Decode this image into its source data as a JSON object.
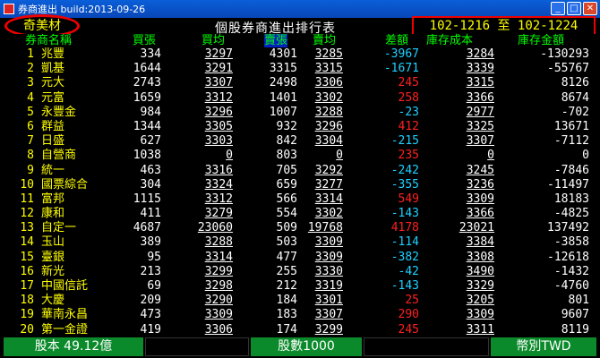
{
  "window": {
    "title": "券商進出 build:2013-09-26",
    "buttons": [
      "_",
      "□",
      "✕"
    ]
  },
  "header": {
    "broker": "奇美材",
    "table_title": "個股券商進出排行表",
    "date_range": "102-1216 至 102-1224"
  },
  "columns": {
    "rank_name": "券商名稱",
    "buy_lots": "買張",
    "buy_avg": "買均",
    "sell_lots": "賣張",
    "sell_avg": "賣均",
    "diff": "差額",
    "cost": "庫存成本",
    "amount": "庫存金額"
  },
  "rows": [
    {
      "no": "1",
      "name": "兆豐",
      "buy": "334",
      "bavg": "3297",
      "sell": "4301",
      "savg": "3285",
      "diff": "-3967",
      "cost": "3284",
      "amt": "-130293"
    },
    {
      "no": "2",
      "name": "凱基",
      "buy": "1644",
      "bavg": "3291",
      "sell": "3315",
      "savg": "3315",
      "diff": "-1671",
      "cost": "3339",
      "amt": "-55767"
    },
    {
      "no": "3",
      "name": "元大",
      "buy": "2743",
      "bavg": "3307",
      "sell": "2498",
      "savg": "3306",
      "diff": "245",
      "cost": "3315",
      "amt": "8126"
    },
    {
      "no": "4",
      "name": "元富",
      "buy": "1659",
      "bavg": "3312",
      "sell": "1401",
      "savg": "3302",
      "diff": "258",
      "cost": "3366",
      "amt": "8674"
    },
    {
      "no": "5",
      "name": "永豐金",
      "buy": "984",
      "bavg": "3296",
      "sell": "1007",
      "savg": "3288",
      "diff": "-23",
      "cost": "2977",
      "amt": "-702"
    },
    {
      "no": "6",
      "name": "群益",
      "buy": "1344",
      "bavg": "3305",
      "sell": "932",
      "savg": "3296",
      "diff": "412",
      "cost": "3325",
      "amt": "13671"
    },
    {
      "no": "7",
      "name": "日盛",
      "buy": "627",
      "bavg": "3303",
      "sell": "842",
      "savg": "3304",
      "diff": "-215",
      "cost": "3307",
      "amt": "-7112"
    },
    {
      "no": "8",
      "name": "自營商",
      "buy": "1038",
      "bavg": "0",
      "sell": "803",
      "savg": "0",
      "diff": "235",
      "cost": "0",
      "amt": "0"
    },
    {
      "no": "9",
      "name": "統一",
      "buy": "463",
      "bavg": "3316",
      "sell": "705",
      "savg": "3292",
      "diff": "-242",
      "cost": "3245",
      "amt": "-7846"
    },
    {
      "no": "10",
      "name": "國票綜合",
      "buy": "304",
      "bavg": "3324",
      "sell": "659",
      "savg": "3277",
      "diff": "-355",
      "cost": "3236",
      "amt": "-11497"
    },
    {
      "no": "11",
      "name": "富邦",
      "buy": "1115",
      "bavg": "3312",
      "sell": "566",
      "savg": "3314",
      "diff": "549",
      "cost": "3309",
      "amt": "18183"
    },
    {
      "no": "12",
      "name": "康和",
      "buy": "411",
      "bavg": "3279",
      "sell": "554",
      "savg": "3302",
      "diff": "-143",
      "cost": "3366",
      "amt": "-4825"
    },
    {
      "no": "13",
      "name": "自定一",
      "buy": "4687",
      "bavg": "23060",
      "sell": "509",
      "savg": "19768",
      "diff": "4178",
      "cost": "23021",
      "amt": "137492"
    },
    {
      "no": "14",
      "name": "玉山",
      "buy": "389",
      "bavg": "3288",
      "sell": "503",
      "savg": "3309",
      "diff": "-114",
      "cost": "3384",
      "amt": "-3858"
    },
    {
      "no": "15",
      "name": "臺銀",
      "buy": "95",
      "bavg": "3314",
      "sell": "477",
      "savg": "3309",
      "diff": "-382",
      "cost": "3308",
      "amt": "-12618"
    },
    {
      "no": "16",
      "name": "新光",
      "buy": "213",
      "bavg": "3299",
      "sell": "255",
      "savg": "3330",
      "diff": "-42",
      "cost": "3490",
      "amt": "-1432"
    },
    {
      "no": "17",
      "name": "中國信託",
      "buy": "69",
      "bavg": "3298",
      "sell": "212",
      "savg": "3319",
      "diff": "-143",
      "cost": "3329",
      "amt": "-4760"
    },
    {
      "no": "18",
      "name": "大慶",
      "buy": "209",
      "bavg": "3290",
      "sell": "184",
      "savg": "3301",
      "diff": "25",
      "cost": "3205",
      "amt": "801"
    },
    {
      "no": "19",
      "name": "華南永昌",
      "buy": "473",
      "bavg": "3309",
      "sell": "183",
      "savg": "3307",
      "diff": "290",
      "cost": "3309",
      "amt": "9607"
    },
    {
      "no": "20",
      "name": "第一金證",
      "buy": "419",
      "bavg": "3306",
      "sell": "174",
      "savg": "3299",
      "diff": "245",
      "cost": "3311",
      "amt": "8119"
    }
  ],
  "status": {
    "capital": "股本 49.12億",
    "unit": "股數1000",
    "currency": "幣別TWD"
  },
  "colors": {
    "positive": "#ff2020",
    "negative": "#1fd0ff",
    "accent_green": "#0a8a2a"
  }
}
